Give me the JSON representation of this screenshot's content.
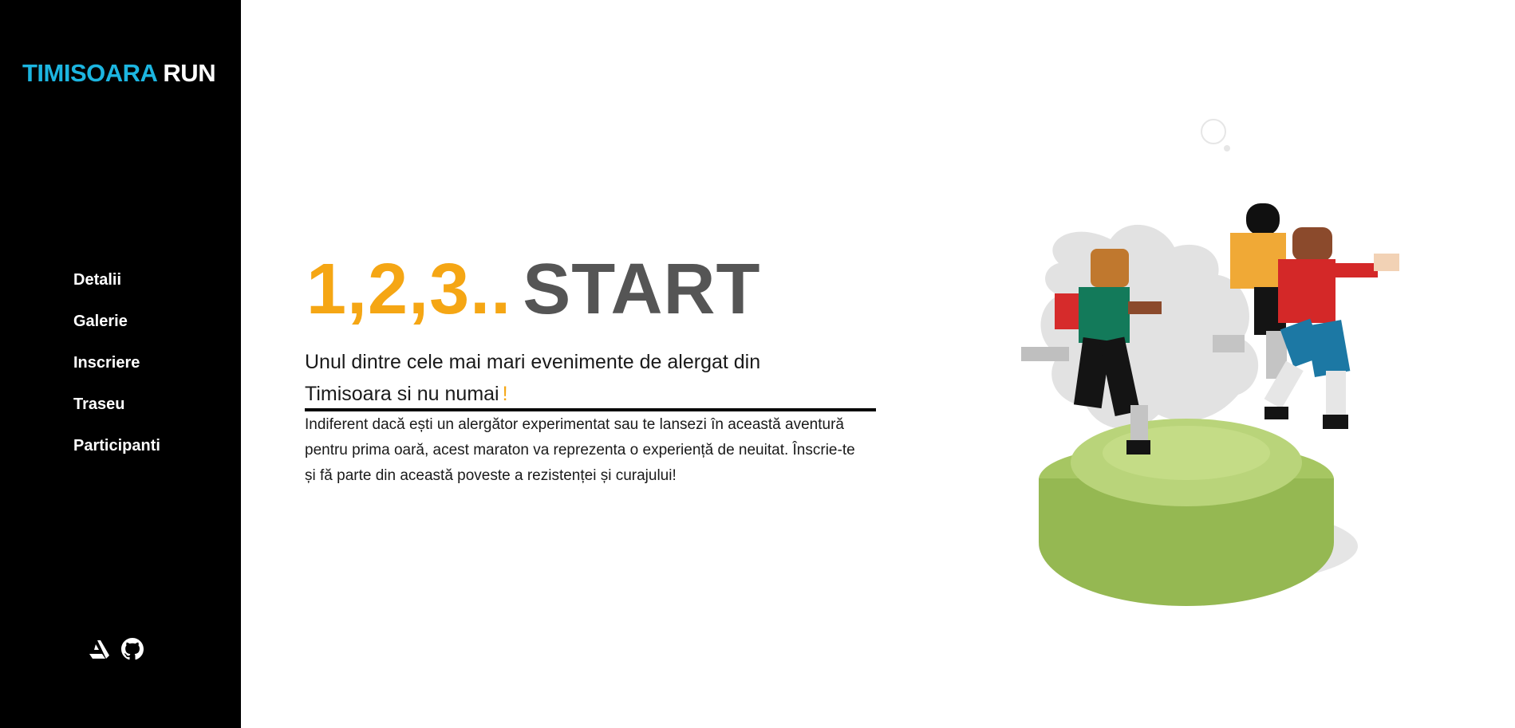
{
  "logo": {
    "accent": "TIMISOARA",
    "plain": "RUN"
  },
  "nav": [
    {
      "label": "Detalii"
    },
    {
      "label": "Galerie"
    },
    {
      "label": "Inscriere"
    },
    {
      "label": "Traseu"
    },
    {
      "label": "Participanti"
    }
  ],
  "social": [
    {
      "icon": "artstation-icon"
    },
    {
      "icon": "github-icon"
    }
  ],
  "hero": {
    "countdown": "1,2,3..",
    "start": "START",
    "subtitle": "Unul dintre cele mai mari evenimente de alergat din Timisoara si nu numai",
    "subtitle_accent": "!",
    "description": "Indiferent dacă ești un alergător experimentat sau te lansezi în această aventură pentru prima oară, acest maraton va reprezenta o experiență de neuitat. Înscrie-te și fă parte din această poveste a rezistenței și curajului!"
  },
  "colors": {
    "sidebar_bg": "#000000",
    "logo_accent": "#1cb5e0",
    "highlight": "#f5a614",
    "start_text": "#555555"
  }
}
